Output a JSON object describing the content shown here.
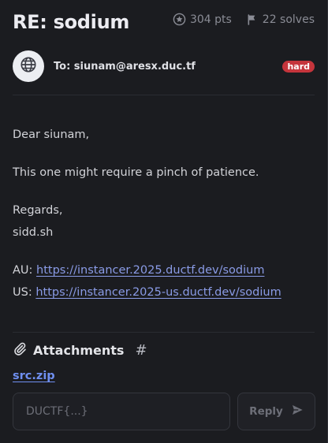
{
  "header": {
    "title": "RE: sodium",
    "points": "304 pts",
    "solves": "22 solves"
  },
  "recipient": {
    "to_label": "To: siunam@aresx.duc.tf",
    "difficulty": "hard",
    "difficulty_color": "#c5353c"
  },
  "message": {
    "greeting": "Dear siunam,",
    "line1": "This one might require a pinch of patience.",
    "signoff": "Regards,",
    "signature": "sidd.sh",
    "au_label": "AU:",
    "au_url": "https://instancer.2025.ductf.dev/sodium",
    "us_label": "US:",
    "us_url": "https://instancer.2025-us.ductf.dev/sodium"
  },
  "attachments": {
    "heading": "Attachments",
    "hash_symbol": "#",
    "files": [
      "src.zip"
    ]
  },
  "flag_form": {
    "placeholder": "DUCTF{...}",
    "value": "",
    "reply_label": "Reply"
  },
  "icons": {
    "points": "star-circle-icon",
    "solves": "flag-icon",
    "avatar": "globe-icon",
    "attachments": "paperclip-icon",
    "reply": "send-icon"
  }
}
